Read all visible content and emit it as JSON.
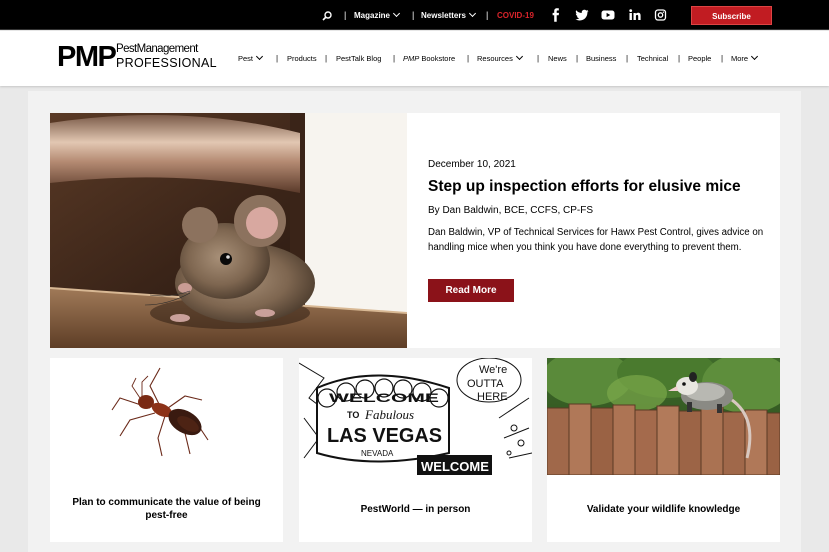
{
  "topbar": {
    "search_icon": "search-icon",
    "magazine": "Magazine",
    "newsletters": "Newsletters",
    "covid": "COVID-19",
    "subscribe": "Subscribe",
    "social_icons": [
      "facebook-icon",
      "twitter-icon",
      "youtube-icon",
      "linkedin-icon",
      "instagram-icon"
    ],
    "covid_color": "#d9242b",
    "subscribe_color": "#c11c22"
  },
  "logo": {
    "short": "PMP",
    "line1": "PestManagement",
    "line2": "PROFESSIONAL"
  },
  "nav": {
    "pest": "Pest",
    "products": "Products",
    "pesttalk_blog": "PestTalk Blog",
    "bookstore_pmp": "PMP",
    "bookstore_rest": " Bookstore",
    "resources": "Resources",
    "news": "News",
    "business": "Business",
    "technical": "Technical",
    "people": "People",
    "more": "More"
  },
  "hero": {
    "date": "December 10, 2021",
    "title": "Step up inspection efforts for elusive mice",
    "byline": "By Dan Baldwin, BCE, CCFS, CP-FS",
    "description": "Dan Baldwin, VP of Technical Services for Hawx Pest Control, gives advice on handling mice when you think you have done everything to prevent them.",
    "button": "Read More",
    "button_color": "#8b1219"
  },
  "cards": [
    {
      "title": "Plan to communicate the value of being pest-free"
    },
    {
      "title": "PestWorld — in person",
      "sign": {
        "welcome": "WELCOME",
        "to": "TO",
        "fabulous": "Fabulous",
        "city": "LAS VEGAS",
        "state": "NEVADA",
        "welcome2": "WELCOME",
        "bubble": "We're OUTTA HERE",
        "bubble_line1": "We're",
        "bubble_line2": "OUTTA",
        "bubble_line3": "HERE"
      }
    },
    {
      "title": "Validate your wildlife knowledge"
    }
  ]
}
